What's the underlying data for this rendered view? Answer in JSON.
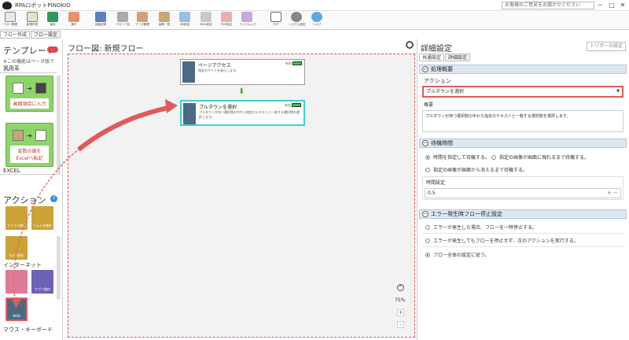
{
  "app": {
    "title": "RPAロボットPINOKIO",
    "inquiry_placeholder": "お客様のご意見をお聞かせください"
  },
  "window_controls": {
    "minimize": "─",
    "maximize": "□",
    "close": "✕"
  },
  "toolbar": [
    {
      "label": "フロー管理",
      "color": "#e8e8e8"
    },
    {
      "label": "新規作成",
      "color": "#d7e6d0"
    },
    {
      "label": "保存",
      "color": "#2b9a5a"
    },
    {
      "label": "実行",
      "color": "#e69070"
    },
    {
      "label": "自動記録",
      "color": "#5b7fbf"
    },
    {
      "label": "フロー一覧",
      "color": "#aaaaaa"
    },
    {
      "label": "データ管理",
      "color": "#d4a07c"
    },
    {
      "label": "画像一覧",
      "color": "#c6a878"
    },
    {
      "label": "DB設定",
      "color": "#9bbde0"
    },
    {
      "label": "MAIL設定",
      "color": "#c9c9c9"
    },
    {
      "label": "PDF設定",
      "color": "#e6b0b0"
    },
    {
      "label": "ファイル入力",
      "color": "#c8a8d8"
    },
    {
      "label": "ログ",
      "color": "#bbbbbb"
    },
    {
      "label": "システム設定",
      "color": "#888888"
    },
    {
      "label": "ヘルプ",
      "color": "#5aaae0"
    }
  ],
  "left_tabs": [
    "フロー作成",
    "フロー設定"
  ],
  "template": {
    "title": "テンプレート",
    "note": "※この機能はベータ版です。",
    "group_general": "汎用系",
    "box1_label": "画面項目に入力",
    "box2_label": "変数の値を\nExcelへ転記",
    "group_excel": "EXCEL"
  },
  "actions": {
    "title": "アクション",
    "help": "?",
    "tiles": [
      {
        "label": "ファイル操作",
        "color": "#caa236"
      },
      {
        "label": "フォルダ操作",
        "color": "#caa236"
      },
      {
        "label": "Excel操作",
        "color": "#caa236"
      },
      {
        "label": "",
        "color": "#e07b97"
      },
      {
        "label": "アプリ操作",
        "color": "#6b62b8"
      },
      {
        "label": "WEB",
        "color": "#4a6a85"
      }
    ],
    "group_internet": "インターネット",
    "group_mouse": "マウス・キーボード"
  },
  "canvas": {
    "title": "フロー図: 新規フロー",
    "node1": {
      "title": "ページアクセス",
      "desc": "指定のサイトを表示します。",
      "status": "有効"
    },
    "node2": {
      "title": "プルダウンを選択",
      "desc": "プルダウンが持つ選択肢の中から指定のテキストと一致する選択肢を選択します。",
      "status": "有効"
    },
    "zoom": "75%",
    "zoom_in": "+",
    "zoom_out": "-"
  },
  "details": {
    "title": "詳細設定",
    "trigger_button": "トリガーの設定",
    "tabs": [
      "共通設定",
      "詳細設定"
    ],
    "section_overview": "処理概要",
    "action_label": "アクション",
    "action_value": "プルダウンを選択",
    "summary_label": "概要",
    "summary_text": "プルダウンが持つ選択肢の中から指定のテキストと一致する選択肢を選択します。",
    "section_wait": "待機時間",
    "wait_options": [
      "時間を指定して待機する。",
      "指定の画像が画面に現れるまで待機する。",
      "指定の画像が画面から消えるまで待機する。"
    ],
    "time_label": "時間設定",
    "time_value": "0.5",
    "section_error": "エラー発生時フロー停止設定",
    "error_options": [
      "エラーが発生した場合、フローを一時停止する。",
      "エラーが発生してもフローを停止せず、次のアクションを実行する。",
      "フロー全体の設定に従う。"
    ]
  }
}
